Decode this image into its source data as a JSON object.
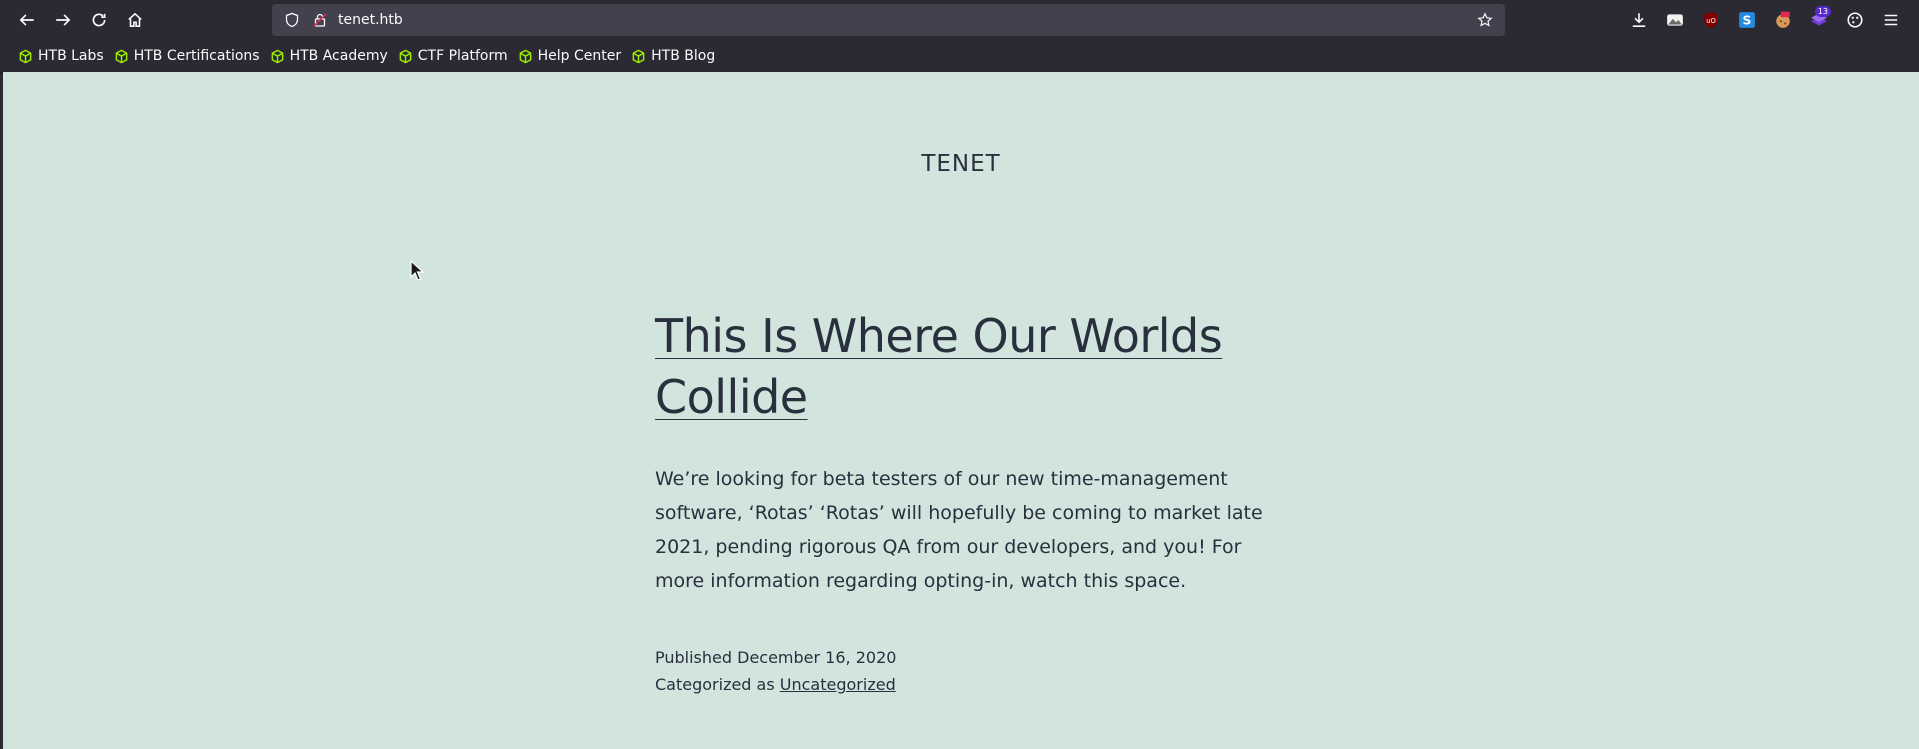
{
  "browser": {
    "url": "tenet.htb",
    "extension_badge_count": "13"
  },
  "bookmarks": [
    {
      "label": "HTB Labs"
    },
    {
      "label": "HTB Certifications"
    },
    {
      "label": "HTB Academy"
    },
    {
      "label": "CTF Platform"
    },
    {
      "label": "Help Center"
    },
    {
      "label": "HTB Blog"
    }
  ],
  "page": {
    "site_title": "TENET",
    "post": {
      "title": "This Is Where Our Worlds Collide",
      "body": "We’re looking for beta testers of our new time-management software, ‘Rotas’ ‘Rotas’ will hopefully be coming to market late 2021, pending rigorous QA from our developers, and you! For more information regarding opting-in, watch this space.",
      "published_prefix": "Published",
      "published_date": "December 16, 2020",
      "category_prefix": "Categorized as",
      "category": "Uncategorized"
    }
  },
  "colors": {
    "page_background": "#d1e4dd",
    "text": "#28303d",
    "toolbar": "#2b2a33",
    "bookmark_icon": "#9fef00"
  }
}
